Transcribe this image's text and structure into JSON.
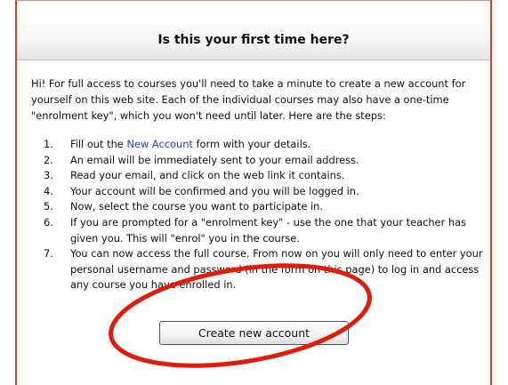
{
  "title": "Is this your first time here?",
  "intro": "Hi! For full access to courses you'll need to take a minute to create a new account for yourself on this web site. Each of the individual courses may also have a one-time \"enrolment key\", which you won't need until later. Here are the steps:",
  "steps": [
    {
      "num": "1.",
      "before": "Fill out the ",
      "link": "New Account",
      "after": " form with your details."
    },
    {
      "num": "2.",
      "text": "An email will be immediately sent to your email address."
    },
    {
      "num": "3.",
      "text": "Read your email, and click on the web link it contains."
    },
    {
      "num": "4.",
      "text": "Your account will be confirmed and you will be logged in."
    },
    {
      "num": "5.",
      "text": "Now, select the course you want to participate in."
    },
    {
      "num": "6.",
      "text": "If you are prompted for a \"enrolment key\" - use the one that your teacher has given you. This will \"enrol\" you in the course."
    },
    {
      "num": "7.",
      "text": "You can now access the full course. From now on you will only need to enter your personal username and password (in the form on this page) to log in and access any course you have enrolled in."
    }
  ],
  "button_label": "Create new account",
  "colors": {
    "panel_border": "#d7412a",
    "highlight_ellipse": "#e01c0c",
    "link": "#1f42d8"
  }
}
